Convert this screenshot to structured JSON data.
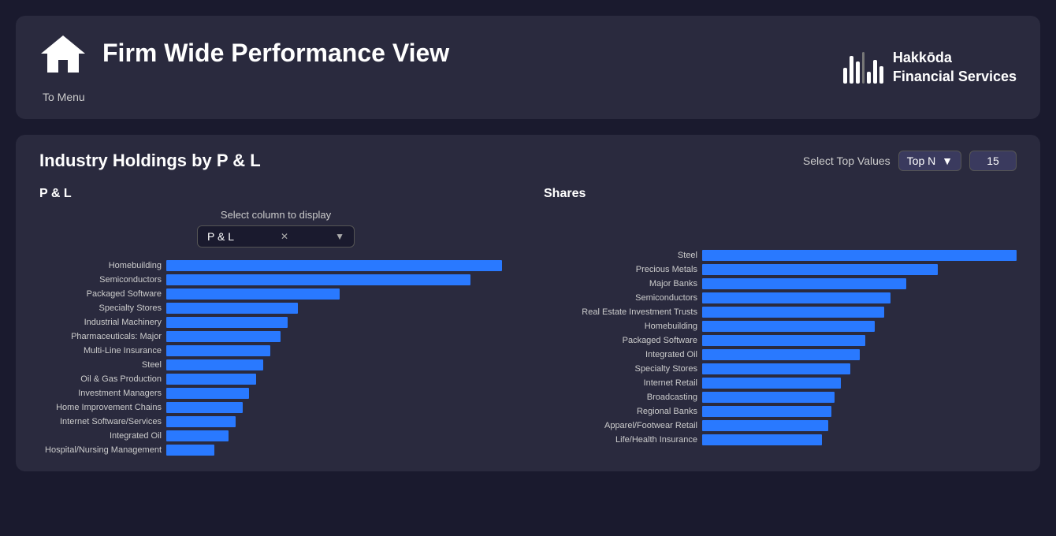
{
  "header": {
    "title": "Firm Wide Performance View",
    "to_menu": "To Menu",
    "brand_name": "Hakkōda\nFinancial Services"
  },
  "section": {
    "title": "Industry Holdings by P & L",
    "select_top_label": "Select Top Values",
    "top_n_option": "Top N",
    "top_n_value": "15"
  },
  "left_chart": {
    "title": "P & L",
    "column_select_label": "Select column to display",
    "column_selected": "P & L",
    "bars": [
      {
        "label": "Homebuilding",
        "pct": 97
      },
      {
        "label": "Semiconductors",
        "pct": 88
      },
      {
        "label": "Packaged Software",
        "pct": 50
      },
      {
        "label": "Specialty Stores",
        "pct": 38
      },
      {
        "label": "Industrial Machinery",
        "pct": 35
      },
      {
        "label": "Pharmaceuticals: Major",
        "pct": 33
      },
      {
        "label": "Multi-Line Insurance",
        "pct": 30
      },
      {
        "label": "Steel",
        "pct": 28
      },
      {
        "label": "Oil & Gas Production",
        "pct": 26
      },
      {
        "label": "Investment Managers",
        "pct": 24
      },
      {
        "label": "Home Improvement Chains",
        "pct": 22
      },
      {
        "label": "Internet Software/Services",
        "pct": 20
      },
      {
        "label": "Integrated Oil",
        "pct": 18
      },
      {
        "label": "Hospital/Nursing Management",
        "pct": 14
      }
    ]
  },
  "right_chart": {
    "title": "Shares",
    "bars": [
      {
        "label": "Steel",
        "pct": 100
      },
      {
        "label": "Precious Metals",
        "pct": 75
      },
      {
        "label": "Major Banks",
        "pct": 65
      },
      {
        "label": "Semiconductors",
        "pct": 60
      },
      {
        "label": "Real Estate Investment Trusts",
        "pct": 58
      },
      {
        "label": "Homebuilding",
        "pct": 55
      },
      {
        "label": "Packaged Software",
        "pct": 52
      },
      {
        "label": "Integrated Oil",
        "pct": 50
      },
      {
        "label": "Specialty Stores",
        "pct": 47
      },
      {
        "label": "Internet Retail",
        "pct": 44
      },
      {
        "label": "Broadcasting",
        "pct": 42
      },
      {
        "label": "Regional Banks",
        "pct": 41
      },
      {
        "label": "Apparel/Footwear Retail",
        "pct": 40
      },
      {
        "label": "Life/Health Insurance",
        "pct": 38
      }
    ]
  }
}
